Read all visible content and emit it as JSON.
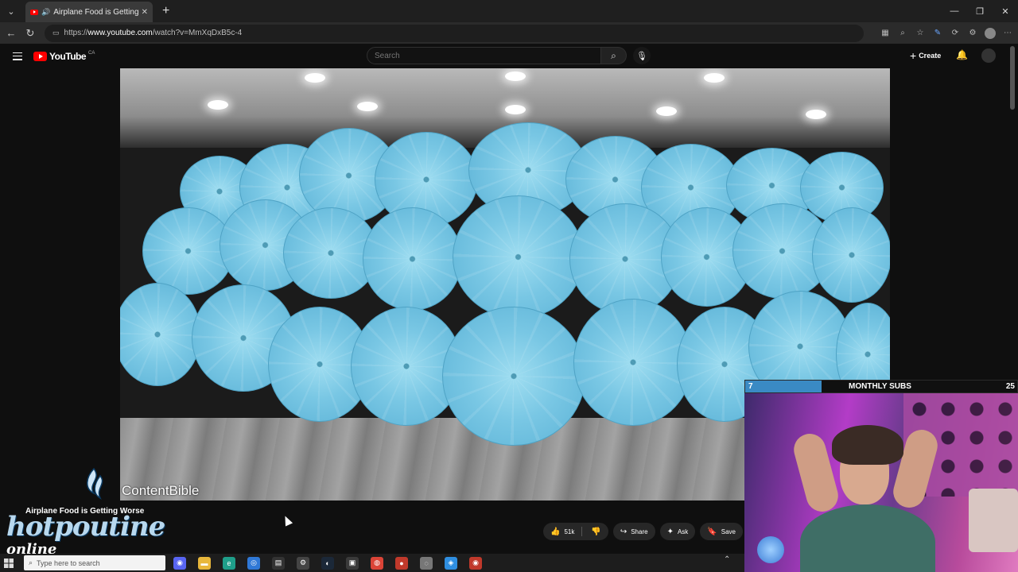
{
  "browser": {
    "tab_title": "Airplane Food is Getting Worse",
    "url_prefix": "https://",
    "url_host": "www.youtube.com",
    "url_path": "/watch?v=MmXqDxB5c-4"
  },
  "youtube": {
    "logo_text": "YouTube",
    "region": "CA",
    "search_placeholder": "Search",
    "create_label": "Create"
  },
  "video": {
    "watermark": "ContentBible",
    "title": "Airplane Food is Getting Worse",
    "channel": "",
    "actions": {
      "likes": "51k",
      "share": "Share",
      "ask": "Ask",
      "save": "Save"
    }
  },
  "stream_overlay": {
    "logo_line1": "hotpoutine",
    "logo_line2": "online",
    "subs_current": "7",
    "subs_label": "MONTHLY SUBS",
    "subs_goal": "25",
    "subs_progress": 0.28
  },
  "taskbar": {
    "search_placeholder": "Type here to search"
  },
  "colors": {
    "youtube_red": "#ff0000",
    "umbrella_blue": "#79c7e4",
    "subs_bar": "#3a8ac4"
  }
}
